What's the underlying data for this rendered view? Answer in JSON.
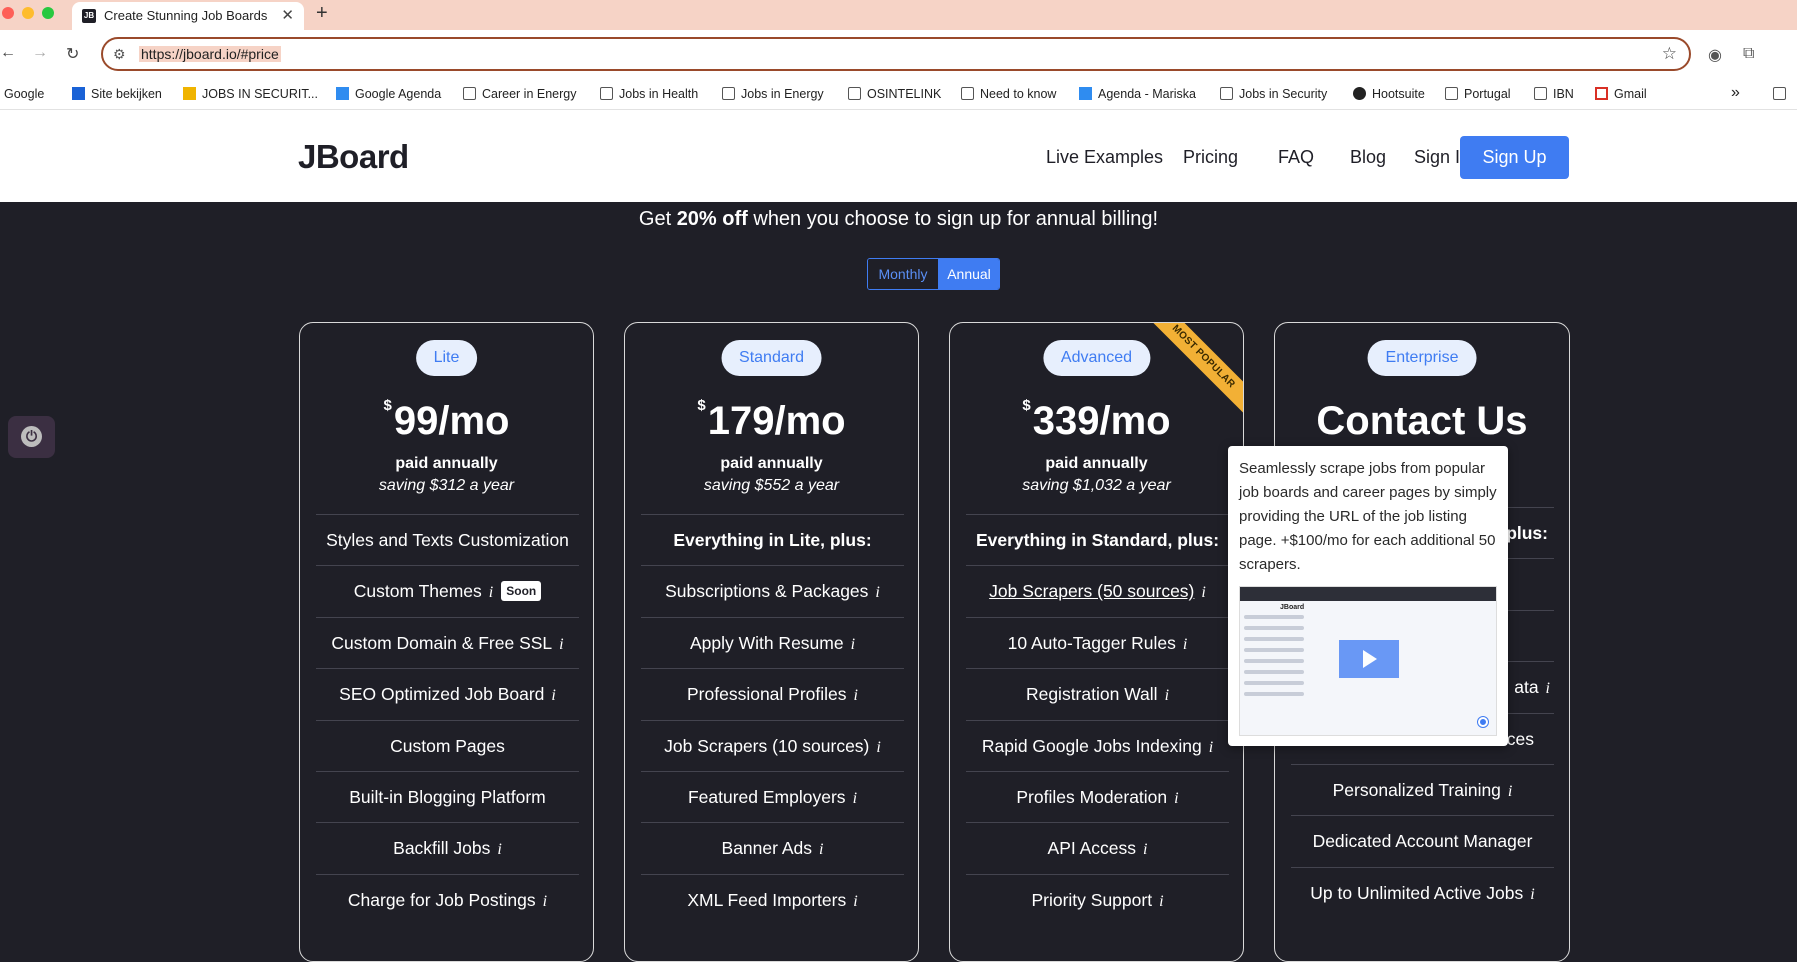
{
  "browser": {
    "tab_title": "Create Stunning Job Boards",
    "tab_favicon": "JB",
    "url": "https://jboard.io/#price",
    "bookmarks": [
      "Google",
      "Site bekijken",
      "JOBS IN SECURIT...",
      "Google Agenda",
      "Career in Energy",
      "Jobs in Health",
      "Jobs in Energy",
      "OSINTELINK",
      "Need to know",
      "Agenda - Mariska",
      "Jobs in Security",
      "Hootsuite",
      "Portugal",
      "IBN",
      "Gmail"
    ],
    "bookmark_overflow": "»"
  },
  "header": {
    "logo": "JBoard",
    "nav": [
      "Live Examples",
      "Pricing",
      "FAQ",
      "Blog",
      "Sign In"
    ],
    "signup": "Sign Up"
  },
  "promo": {
    "prefix": "Get ",
    "bold": "20% off",
    "suffix": " when you choose to sign up for annual billing!"
  },
  "billing_toggle": {
    "monthly": "Monthly",
    "annual": "Annual",
    "selected": "Annual"
  },
  "plans": [
    {
      "name": "Lite",
      "currency": "$",
      "price": "99/mo",
      "paid": "paid annually",
      "saving": "saving $312 a year",
      "features": [
        {
          "text": "Styles and Texts Customization",
          "info": ""
        },
        {
          "text": "Custom Themes",
          "info": "i",
          "tag": "Soon"
        },
        {
          "text": "Custom Domain & Free SSL",
          "info": "i"
        },
        {
          "text": "SEO Optimized Job Board",
          "info": "i"
        },
        {
          "text": "Custom Pages",
          "info": ""
        },
        {
          "text": "Built-in Blogging Platform",
          "info": ""
        },
        {
          "text": "Backfill Jobs",
          "info": "i"
        },
        {
          "text": "Charge for Job Postings",
          "info": "i"
        }
      ]
    },
    {
      "name": "Standard",
      "currency": "$",
      "price": "179/mo",
      "paid": "paid annually",
      "saving": "saving $552 a year",
      "features": [
        {
          "text": "Everything in Lite, plus:",
          "info": "",
          "strong": true
        },
        {
          "text": "Subscriptions & Packages",
          "info": "i"
        },
        {
          "text": "Apply With Resume",
          "info": "i"
        },
        {
          "text": "Professional Profiles",
          "info": "i"
        },
        {
          "text": "Job Scrapers (10 sources)",
          "info": "i"
        },
        {
          "text": "Featured Employers",
          "info": "i"
        },
        {
          "text": "Banner Ads",
          "info": "i"
        },
        {
          "text": "XML Feed Importers",
          "info": "i"
        }
      ]
    },
    {
      "name": "Advanced",
      "ribbon": "MOST POPULAR",
      "currency": "$",
      "price": "339/mo",
      "paid": "paid annually",
      "saving": "saving $1,032 a year",
      "features": [
        {
          "text": "Everything in Standard, plus:",
          "info": "",
          "strong": true
        },
        {
          "text": "Job Scrapers (50 sources)",
          "info": "i",
          "link": true
        },
        {
          "text": "10 Auto-Tagger Rules",
          "info": "i"
        },
        {
          "text": "Registration Wall",
          "info": "i"
        },
        {
          "text": "Rapid Google Jobs Indexing",
          "info": "i"
        },
        {
          "text": "Profiles Moderation",
          "info": "i"
        },
        {
          "text": "API Access",
          "info": "i"
        },
        {
          "text": "Priority Support",
          "info": "i"
        }
      ]
    },
    {
      "name": "Enterprise",
      "title": "Contact Us",
      "features": [
        {
          "text": "plus:",
          "info": "",
          "strong": true,
          "partial": true
        },
        {
          "text": "",
          "info": ""
        },
        {
          "text": "",
          "info": ""
        },
        {
          "text": "ata",
          "info": "i",
          "partial": true
        },
        {
          "text": "ces",
          "info": "",
          "partial": true
        },
        {
          "text": "Personalized Training",
          "info": "i"
        },
        {
          "text": "Dedicated Account Manager",
          "info": ""
        },
        {
          "text": "Up to Unlimited Active Jobs",
          "info": "i"
        }
      ]
    }
  ],
  "tooltip": {
    "text": "Seamlessly scrape jobs from popular job boards and career pages by simply providing the URL of the job listing page. +$100/mo for each additional 50 scrapers.",
    "video_logo": "JBoard"
  },
  "colors": {
    "accent": "#3f7cf2",
    "background": "#1f1f27",
    "ribbon": "#f2b035"
  }
}
